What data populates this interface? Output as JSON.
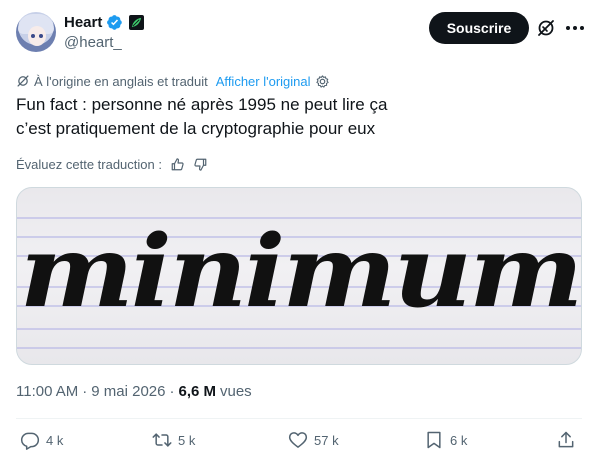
{
  "author": {
    "display_name": "Heart",
    "handle": "@heart_",
    "avatar_icon": "anime-avatar"
  },
  "header": {
    "subscribe_label": "Souscrire",
    "grok_icon": "grok-icon",
    "more_icon": "more-icon"
  },
  "translation": {
    "notice": "À l'origine en anglais et traduit",
    "show_original": "Afficher l'original",
    "rate_label": "Évaluez cette traduction :"
  },
  "tweet": {
    "line1": "Fun fact : personne né après 1995 ne peut lire ça",
    "line2": "c’est pratiquement de la cryptographie pour eux"
  },
  "media": {
    "handwritten_word": "minimum"
  },
  "meta": {
    "time": "11:00 AM",
    "separator": "·",
    "date": "9 mai 2026",
    "separator2": "·",
    "views_count": "6,6 M",
    "views_label": "vues"
  },
  "actions": {
    "replies": "4 k",
    "reposts": "5 k",
    "likes": "57 k",
    "bookmarks": "6 k"
  },
  "colors": {
    "accent": "#1d9bf0",
    "text": "#0f1419",
    "muted": "#536471"
  }
}
